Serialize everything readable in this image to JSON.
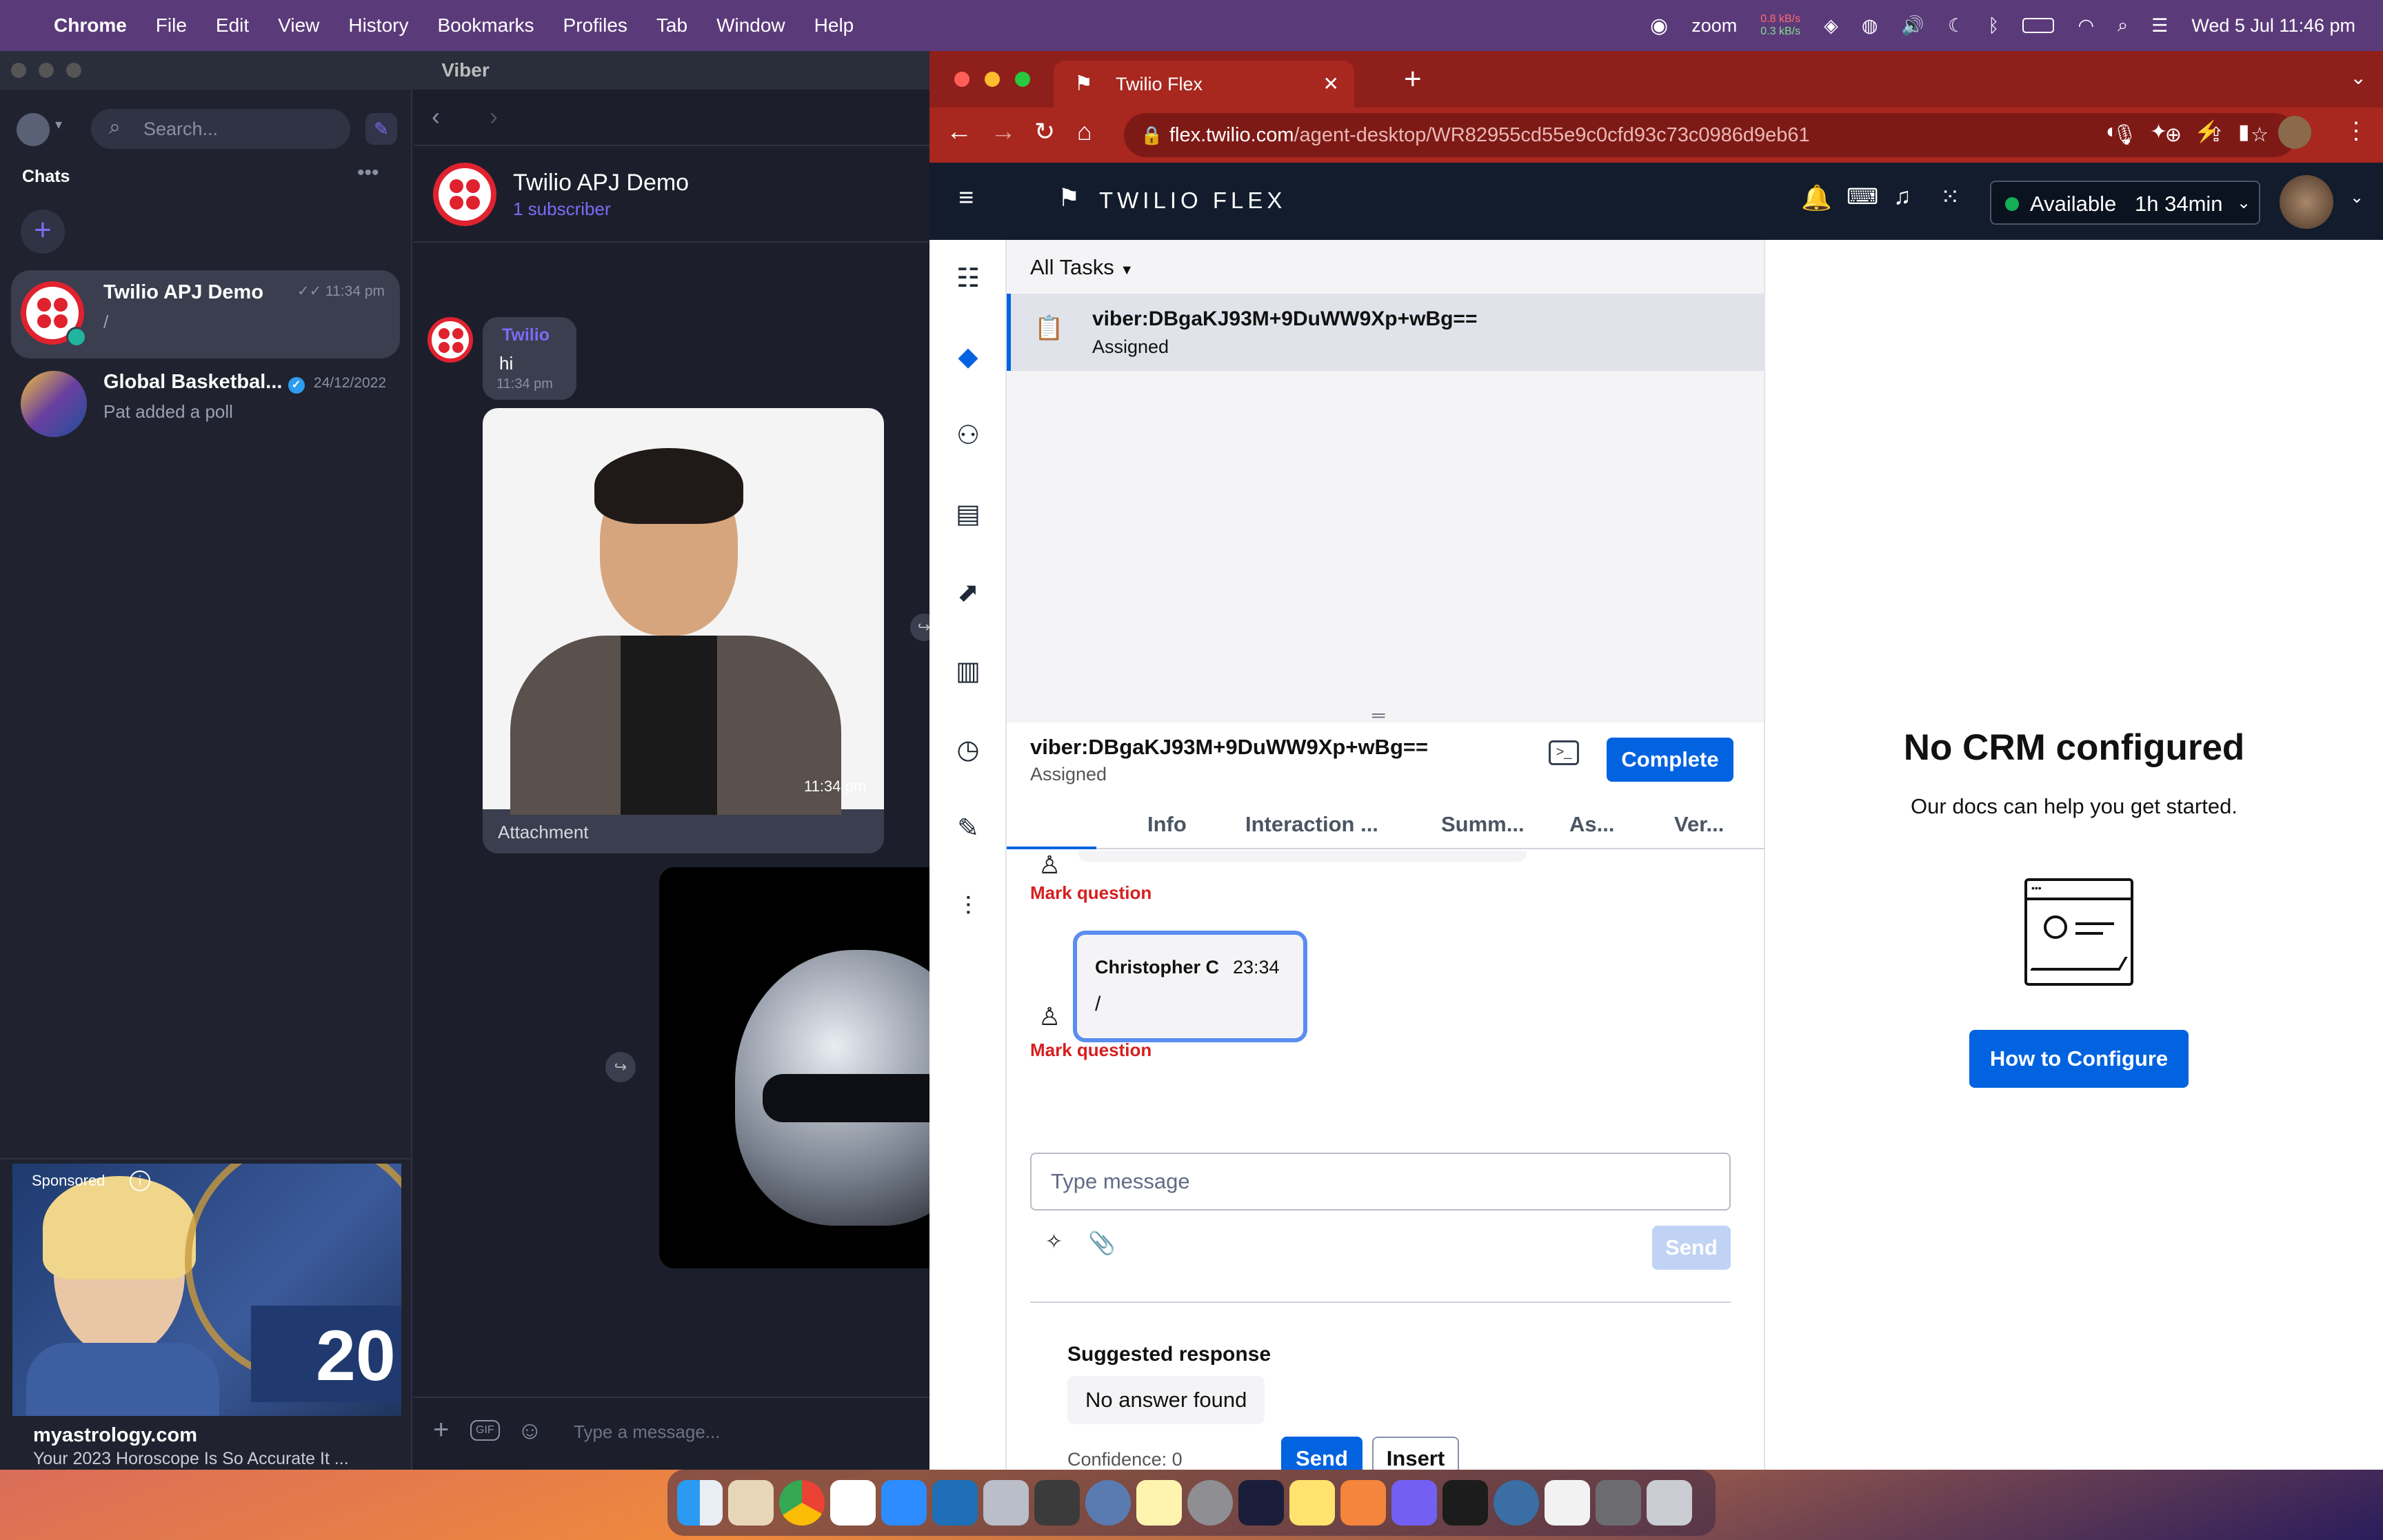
{
  "menubar": {
    "app": "Chrome",
    "items": [
      "File",
      "Edit",
      "View",
      "History",
      "Bookmarks",
      "Profiles",
      "Tab",
      "Window",
      "Help"
    ],
    "zoom": "zoom",
    "net_up": "0.8 kB/s",
    "net_down": "0.3 kB/s",
    "datetime": "Wed 5 Jul  11:46 pm"
  },
  "viber": {
    "window_title": "Viber",
    "search_placeholder": "Search...",
    "section": "Chats",
    "chats": [
      {
        "name": "Twilio APJ Demo",
        "snippet": "/",
        "time": "11:34 pm"
      },
      {
        "name": "Global Basketbal...",
        "snippet": "Pat added a poll",
        "time": "24/12/2022"
      }
    ],
    "ad": {
      "label": "Sponsored",
      "number": "20",
      "domain": "myastrology.com",
      "text": "Your 2023 Horoscope Is So Accurate It ..."
    },
    "conversation": {
      "title": "Twilio APJ Demo",
      "subtitle": "1 subscriber",
      "sender": "Twilio",
      "message": "hi",
      "msg_time": "11:34 pm",
      "photo_time": "11:34 pm",
      "attachment": "Attachment",
      "input_placeholder": "Type a message...",
      "gif": "GIF"
    }
  },
  "chrome": {
    "tab_title": "Twilio Flex",
    "url_host": "flex.twilio.com",
    "url_path": "/agent-desktop/WR82955cd55e9c0cfd93c73c0986d9eb61"
  },
  "flex": {
    "brand": "TWILIO FLEX",
    "status": "Available",
    "status_time": "1h 34min",
    "tasks_filter": "All Tasks",
    "task": {
      "name": "viber:DBgaKJ93M+9DuWW9Xp+wBg==",
      "state": "Assigned"
    },
    "panel": {
      "title": "viber:DBgaKJ93M+9DuWW9Xp+wBg==",
      "state": "Assigned",
      "complete": "Complete",
      "tabs": [
        "Info",
        "Interaction ...",
        "Summ...",
        "As...",
        "Ver..."
      ],
      "mark_question": "Mark question",
      "message": {
        "author": "Christopher C",
        "time": "23:34",
        "body": "/"
      },
      "input_placeholder": "Type message",
      "send": "Send",
      "suggested_title": "Suggested response",
      "suggested_text": "No answer found",
      "confidence": "Confidence: 0",
      "suggest_send": "Send",
      "insert": "Insert"
    },
    "crm": {
      "title": "No CRM configured",
      "subtitle": "Our docs can help you get started.",
      "button": "How to Configure"
    }
  },
  "colors": {
    "twilio_red": "#e0222f",
    "flex_blue": "#0263e0",
    "flex_navy": "#121c2d",
    "chrome_red": "#a8271f"
  }
}
